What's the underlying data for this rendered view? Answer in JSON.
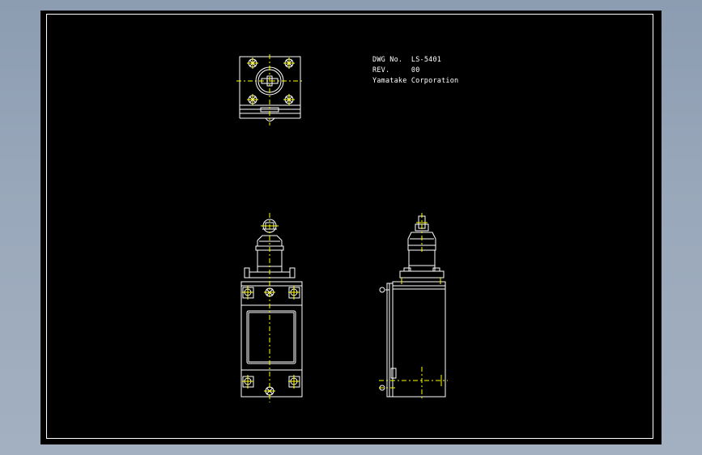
{
  "drawing": {
    "title_block": {
      "dwg_label": "DWG No.",
      "dwg_no": "LS-5401",
      "rev_label": "REV.",
      "rev_value": "00",
      "company": "Yamatake Corporation"
    },
    "colors": {
      "background": "#000000",
      "border": "#ffffff",
      "outline": "#ffffff",
      "centerline": "#ffff00"
    }
  }
}
